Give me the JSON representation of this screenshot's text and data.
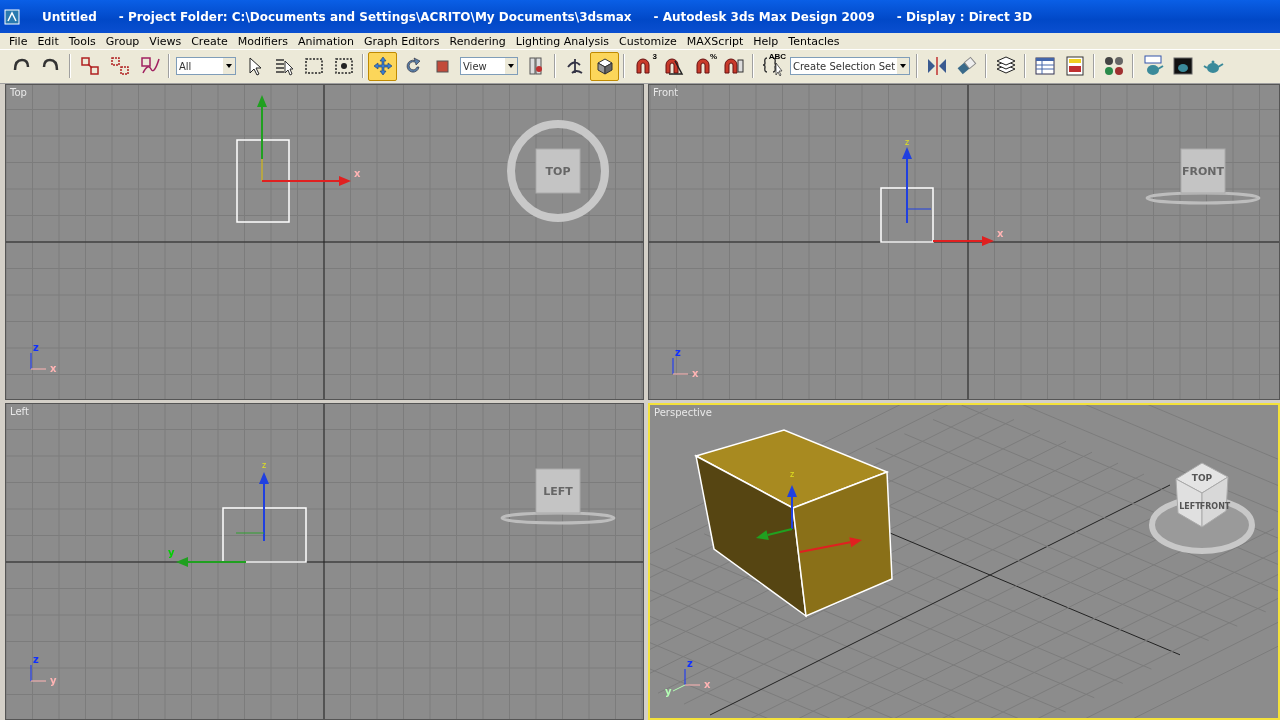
{
  "window": {
    "title_segments": [
      "Untitled",
      "- Project Folder: C:\\Documents and Settings\\ACRITO\\My Documents\\3dsmax",
      "- Autodesk 3ds Max Design 2009",
      "- Display : Direct 3D"
    ]
  },
  "menu": [
    "File",
    "Edit",
    "Tools",
    "Group",
    "Views",
    "Create",
    "Modifiers",
    "Animation",
    "Graph Editors",
    "Rendering",
    "Lighting Analysis",
    "Customize",
    "MAXScript",
    "Help",
    "Tentacles"
  ],
  "toolbar": [
    {
      "kind": "button",
      "selected": false
    },
    {
      "kind": "button",
      "selected": false
    },
    {
      "kind": "separator"
    },
    {
      "kind": "button",
      "selected": false
    },
    {
      "kind": "button",
      "selected": false
    },
    {
      "kind": "button",
      "selected": false
    },
    {
      "kind": "separator"
    },
    {
      "kind": "dropdown",
      "value": "All"
    },
    {
      "kind": "button",
      "selected": false
    },
    {
      "kind": "button",
      "selected": false
    },
    {
      "kind": "button",
      "selected": false
    },
    {
      "kind": "button",
      "selected": false
    },
    {
      "kind": "separator"
    },
    {
      "kind": "button",
      "selected": true
    },
    {
      "kind": "button",
      "selected": false
    },
    {
      "kind": "button",
      "selected": false
    },
    {
      "kind": "dropdown",
      "value": "View"
    },
    {
      "kind": "button",
      "selected": false
    },
    {
      "kind": "separator"
    },
    {
      "kind": "button",
      "selected": false
    },
    {
      "kind": "button",
      "selected": true
    },
    {
      "kind": "separator"
    },
    {
      "kind": "button",
      "selected": false,
      "badge": "3"
    },
    {
      "kind": "button",
      "selected": false
    },
    {
      "kind": "button",
      "selected": false,
      "badge": "%"
    },
    {
      "kind": "button",
      "selected": false
    },
    {
      "kind": "separator"
    },
    {
      "kind": "button",
      "selected": false,
      "badge": "ABC"
    },
    {
      "kind": "dropdown",
      "value": "Create Selection Set"
    },
    {
      "kind": "separator"
    },
    {
      "kind": "button",
      "selected": false
    },
    {
      "kind": "button",
      "selected": false
    },
    {
      "kind": "separator"
    },
    {
      "kind": "button",
      "selected": false
    },
    {
      "kind": "separator"
    },
    {
      "kind": "button",
      "selected": false
    },
    {
      "kind": "button",
      "selected": false
    },
    {
      "kind": "separator"
    },
    {
      "kind": "button",
      "selected": false
    },
    {
      "kind": "separator"
    },
    {
      "kind": "button",
      "selected": false
    },
    {
      "kind": "button",
      "selected": false
    },
    {
      "kind": "button",
      "selected": false
    }
  ],
  "viewports": [
    {
      "kind": "top",
      "label": "Top",
      "selected": false,
      "cube_labels": [
        "TOP"
      ],
      "gizmo_axes": [
        "x"
      ],
      "corner_axes": [
        "z",
        "x"
      ]
    },
    {
      "kind": "front",
      "label": "Front",
      "selected": false,
      "cube_labels": [
        "FRONT"
      ],
      "gizmo_axes": [
        "z",
        "x"
      ],
      "corner_axes": [
        "z",
        "x"
      ]
    },
    {
      "kind": "left",
      "label": "Left",
      "selected": false,
      "cube_labels": [
        "LEFT"
      ],
      "gizmo_axes": [
        "z",
        "y"
      ],
      "corner_axes": [
        "z",
        "y"
      ]
    },
    {
      "kind": "perspective",
      "label": "Perspective",
      "selected": true,
      "cube_labels": [
        "TOP",
        "LEFT",
        "FRONT"
      ],
      "gizmo_axes": [
        "z"
      ],
      "corner_axes": [
        "z",
        "x",
        "y"
      ]
    }
  ]
}
